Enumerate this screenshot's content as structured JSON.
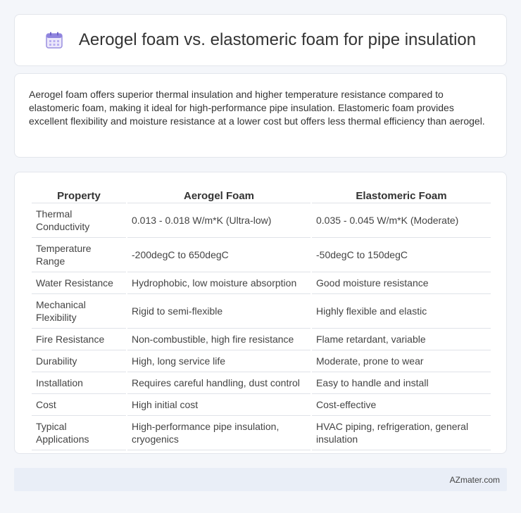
{
  "header": {
    "title": "Aerogel foam vs. elastomeric foam for pipe insulation",
    "icon": "calendar-icon"
  },
  "summary": {
    "text": "Aerogel foam offers superior thermal insulation and higher temperature resistance compared to elastomeric foam, making it ideal for high-performance pipe insulation. Elastomeric foam provides excellent flexibility and moisture resistance at a lower cost but offers less thermal efficiency than aerogel."
  },
  "table": {
    "headers": [
      "Property",
      "Aerogel Foam",
      "Elastomeric Foam"
    ],
    "rows": [
      [
        "Thermal Conductivity",
        "0.013 - 0.018 W/m*K (Ultra-low)",
        "0.035 - 0.045 W/m*K (Moderate)"
      ],
      [
        "Temperature Range",
        "-200degC to 650degC",
        "-50degC to 150degC"
      ],
      [
        "Water Resistance",
        "Hydrophobic, low moisture absorption",
        "Good moisture resistance"
      ],
      [
        "Mechanical Flexibility",
        "Rigid to semi-flexible",
        "Highly flexible and elastic"
      ],
      [
        "Fire Resistance",
        "Non-combustible, high fire resistance",
        "Flame retardant, variable"
      ],
      [
        "Durability",
        "High, long service life",
        "Moderate, prone to wear"
      ],
      [
        "Installation",
        "Requires careful handling, dust control",
        "Easy to handle and install"
      ],
      [
        "Cost",
        "High initial cost",
        "Cost-effective"
      ],
      [
        "Typical Applications",
        "High-performance pipe insulation, cryogenics",
        "HVAC piping, refrigeration, general insulation"
      ]
    ]
  },
  "footer": {
    "text": "AZmater.com"
  },
  "colors": {
    "background": "#f4f6fa",
    "card": "#ffffff",
    "footer_bg": "#e9eef7",
    "icon_accent": "#7b6fd6"
  }
}
